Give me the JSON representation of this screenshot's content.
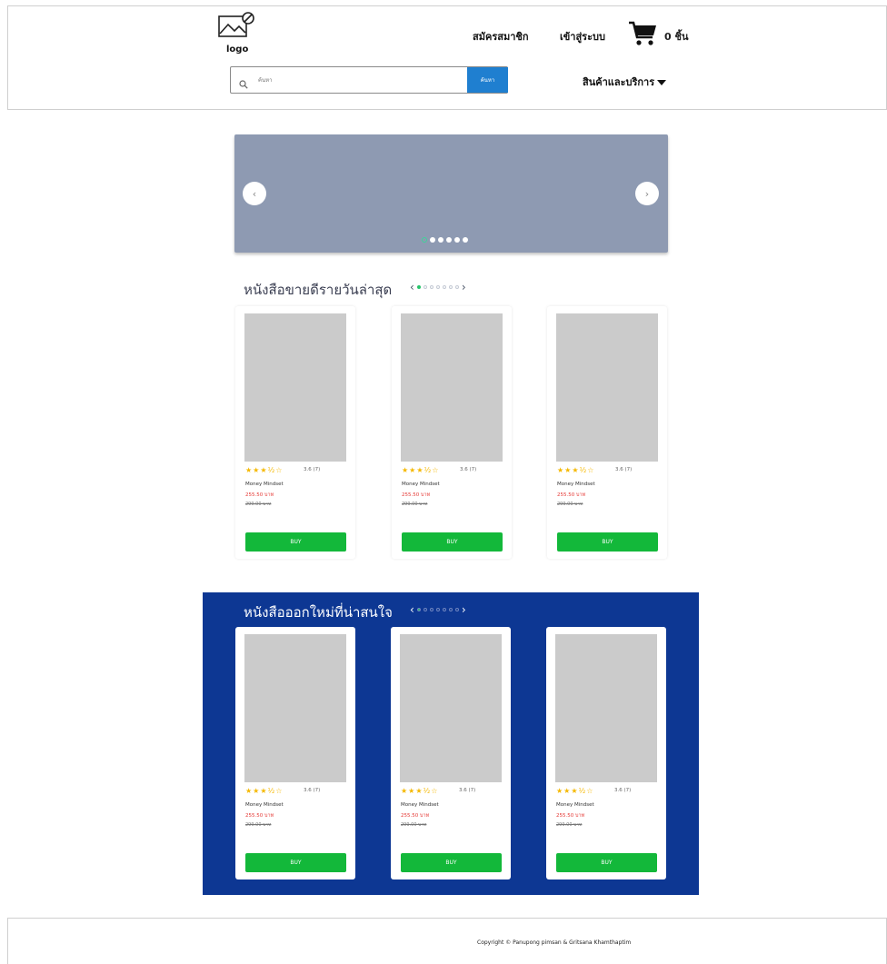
{
  "header": {
    "logo_text": "logo",
    "register_label": "สมัครสมาชิก",
    "login_label": "เข้าสู่ระบบ",
    "cart_count": "0 ชิ้น"
  },
  "search": {
    "placeholder": "ค้นหา",
    "button_label": "ค้นหา"
  },
  "menu": {
    "products_label": "สินค้าและบริการ"
  },
  "hero": {
    "prev_label": "‹",
    "next_label": "›",
    "dot_count": 6,
    "active_dot": 0,
    "background_color": "#8e9ab2"
  },
  "bestsellers": {
    "title": "หนังสือขายดีรายวันล่าสุด",
    "prev_label": "‹",
    "next_label": "›",
    "dot_count": 7,
    "active_dot": 0,
    "products": [
      {
        "stars": "★★★½☆",
        "rating": "3.6 (7)",
        "name": "Money Mindset",
        "price": "255.50 บาท",
        "old_price": "299.00 บาท",
        "buy_label": "BUY"
      },
      {
        "stars": "★★★½☆",
        "rating": "3.6 (7)",
        "name": "Money Mindset",
        "price": "255.50 บาท",
        "old_price": "299.00 บาท",
        "buy_label": "BUY"
      },
      {
        "stars": "★★★½☆",
        "rating": "3.6 (7)",
        "name": "Money Mindset",
        "price": "255.50 บาท",
        "old_price": "299.00 บาท",
        "buy_label": "BUY"
      }
    ]
  },
  "new_arrivals": {
    "title": "หนังสือออกใหม่ที่น่าสนใจ",
    "prev_label": "‹",
    "next_label": "›",
    "dot_count": 7,
    "active_dot": 0,
    "background_color": "#0d3793",
    "products": [
      {
        "stars": "★★★½☆",
        "rating": "3.6 (7)",
        "name": "Money Mindset",
        "price": "255.50 บาท",
        "old_price": "299.00 บาท",
        "buy_label": "BUY"
      },
      {
        "stars": "★★★½☆",
        "rating": "3.6 (7)",
        "name": "Money Mindset",
        "price": "255.50 บาท",
        "old_price": "299.00 บาท",
        "buy_label": "BUY"
      },
      {
        "stars": "★★★½☆",
        "rating": "3.6 (7)",
        "name": "Money Mindset",
        "price": "255.50 บาท",
        "old_price": "299.00 บาท",
        "buy_label": "BUY"
      }
    ]
  },
  "footer": {
    "copyright": "Copyright © Panupong pimsan & Gritsana Khamthaptim"
  },
  "colors": {
    "buy_button": "#13b83a",
    "search_button": "#1f7fd0",
    "price": "#e53935",
    "star": "#f5b800"
  },
  "icons": [
    "image-logo-icon",
    "cart-icon",
    "search-icon",
    "caret-down-icon",
    "chevron-left-icon",
    "chevron-right-icon",
    "star-icon"
  ]
}
